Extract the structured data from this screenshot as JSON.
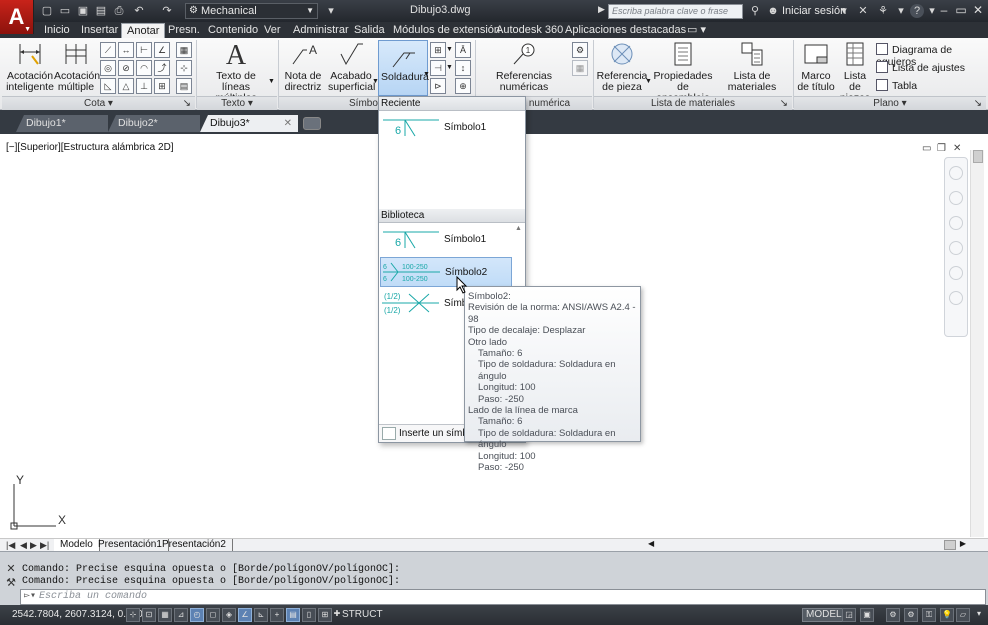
{
  "titlebar": {
    "workspace": "Mechanical",
    "document_title": "Dibujo3.dwg",
    "search_placeholder": "Escriba palabra clave o frase",
    "login": "Iniciar sesión",
    "help": "?"
  },
  "ribbon_tabs": [
    "Inicio",
    "Insertar",
    "Anotar",
    "Presn.",
    "Contenido",
    "Ver",
    "Administrar",
    "Salida",
    "Módulos de extensión",
    "Autodesk 360",
    "Aplicaciones destacadas"
  ],
  "ribbon": {
    "cota": {
      "acotacion_inteligente": "Acotación inteligente",
      "acotacion_multiple": "Acotación múltiple",
      "panel_label": "Cota"
    },
    "texto": {
      "texto_lineas_multiples": "Texto de líneas múltiples",
      "panel_label": "Texto"
    },
    "simbolo": {
      "nota_directriz": "Nota de directriz",
      "acabado_superficial": "Acabado superficial",
      "soldadura": "Soldadura",
      "panel_label": "Símbolo"
    },
    "referencias": {
      "referencias_numericas": "Referencias numéricas",
      "panel_label": "Referencia numérica"
    },
    "lista_materiales": {
      "referencia_pieza": "Referencia de pieza",
      "propiedades_ensamblaje": "Propiedades de ensamblaje",
      "lista_materiales": "Lista de materiales",
      "panel_label": "Lista de materiales"
    },
    "plano": {
      "marco_titulo": "Marco de título",
      "lista_piezas": "Lista de piezas",
      "diagrama_agujeros": "Diagrama de agujeros",
      "lista_ajustes": "Lista de ajustes",
      "tabla": "Tabla",
      "panel_label": "Plano"
    }
  },
  "doc_tabs": [
    "Dibujo1*",
    "Dibujo2*",
    "Dibujo3*"
  ],
  "viewport_label": "[−][Superior][Estructura alámbrica 2D]",
  "ucs": {
    "x": "X",
    "y": "Y"
  },
  "layout_tabs": [
    "Modelo",
    "Presentación1",
    "Presentación2"
  ],
  "command": {
    "history": [
      "Comando: Precise esquina opuesta o [Borde/polígonOV/polígonOC]:",
      "Comando: Precise esquina opuesta o [Borde/polígonOV/polígonOC]:"
    ],
    "placeholder": "Escriba un comando"
  },
  "status": {
    "coordinates": "2542.7804, 2607.3124, 0.0000",
    "struct": "STRUCT",
    "modelo": "MODELO"
  },
  "gallery": {
    "recent_header": "Reciente",
    "library_header": "Biblioteca",
    "recent_items": [
      {
        "label": "Símbolo1"
      }
    ],
    "library_items": [
      {
        "label": "Símbolo1"
      },
      {
        "label": "Símbolo2"
      },
      {
        "label": "Símb"
      }
    ],
    "footer": "Inserte un símb",
    "symbol_texts": {
      "s1": "6",
      "s2_top": "6",
      "s2_top_vals": "100-250",
      "s2_bot": "6",
      "s2_bot_vals": "100-250",
      "s3_top": "(1/2)",
      "s3_bot": "(1/2)"
    }
  },
  "tooltip": {
    "title": "Símbolo2:",
    "norma": "Revisión de la norma: ANSI/AWS A2.4 - 98",
    "decalaje": "Tipo de decalaje: Desplazar",
    "otro_lado": "Otro lado",
    "otro_tamano": "Tamaño: 6",
    "otro_tipo": "Tipo de soldadura: Soldadura en ángulo",
    "otro_longitud": "Longitud: 100",
    "otro_paso": "Paso: -250",
    "lado_marca": "Lado de la línea de marca",
    "marca_tamano": "Tamaño: 6",
    "marca_tipo": "Tipo de soldadura: Soldadura en ángulo",
    "marca_longitud": "Longitud: 100",
    "marca_paso": "Paso: -250"
  },
  "colors": {
    "weld_symbol": "#1aa8a8",
    "selection": "#c6dff8",
    "title_bar": "#2b2f35"
  }
}
